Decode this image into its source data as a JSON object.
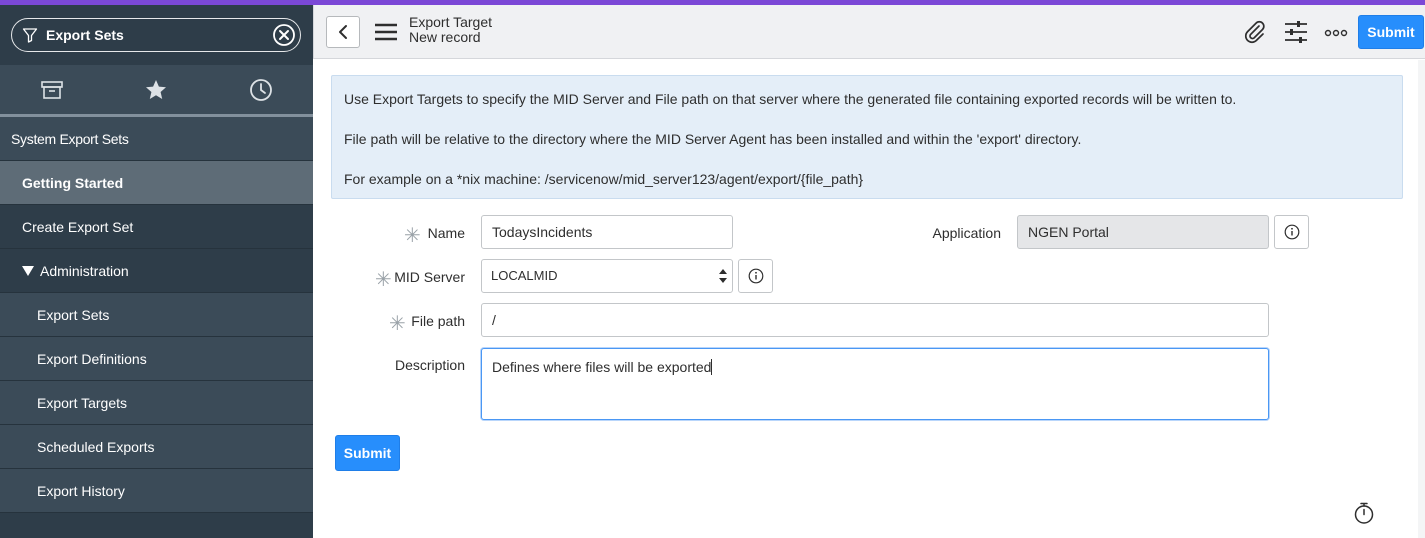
{
  "sidebar": {
    "filter": {
      "value": "Export Sets"
    },
    "tabs": [
      {
        "name": "all-applications",
        "icon": "archive-icon"
      },
      {
        "name": "favorites",
        "icon": "star-icon"
      },
      {
        "name": "history",
        "icon": "clock-icon"
      }
    ],
    "module_title": "System Export Sets",
    "items": [
      {
        "label": "Getting Started"
      },
      {
        "label": "Create Export Set"
      },
      {
        "label": "Administration"
      },
      {
        "label": "Export Sets"
      },
      {
        "label": "Export Definitions"
      },
      {
        "label": "Export Targets"
      },
      {
        "label": "Scheduled Exports"
      },
      {
        "label": "Export History"
      }
    ]
  },
  "header": {
    "title": "Export Target",
    "subtitle": "New record",
    "submit_label": "Submit",
    "icons": [
      "back-icon",
      "menu-icon",
      "paperclip-icon",
      "sliders-icon",
      "more-icon"
    ]
  },
  "info": {
    "lines": [
      "Use Export Targets to specify the MID Server and File path on that server where the generated file containing exported records will be written to.",
      "File path will be relative to the directory where the MID Server Agent has been installed and within the 'export' directory.",
      "For example on a *nix machine: /servicenow/mid_server123/agent/export/{file_path}"
    ]
  },
  "form": {
    "name": {
      "label": "Name",
      "value": "TodaysIncidents"
    },
    "application": {
      "label": "Application",
      "value": "NGEN Portal"
    },
    "mid_server": {
      "label": "MID Server",
      "value": "LOCALMID"
    },
    "file_path": {
      "label": "File path",
      "value": "/"
    },
    "description": {
      "label": "Description",
      "value": "Defines where files will be exported"
    },
    "submit_label": "Submit"
  },
  "colors": {
    "accent": "#278efc",
    "sidebar_bg": "#2e3d49",
    "top_line": "#7b48d6",
    "info_bg": "#e4eef8"
  }
}
